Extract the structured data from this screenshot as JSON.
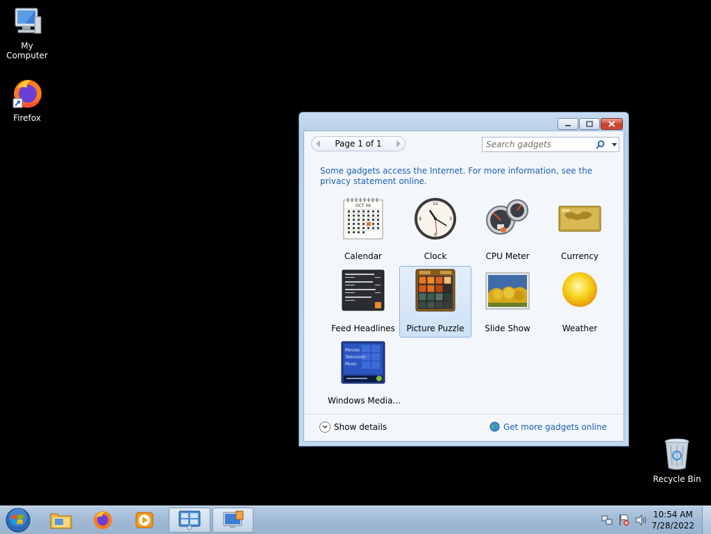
{
  "desktop": {
    "icons": [
      {
        "label": "My Computer"
      },
      {
        "label": "Firefox"
      },
      {
        "label": "Recycle Bin"
      }
    ]
  },
  "window": {
    "pager": {
      "text": "Page 1 of 1"
    },
    "search": {
      "placeholder": "Search gadgets"
    },
    "info_text": "Some gadgets access the Internet.  For more information, see the privacy statement online.",
    "gadgets": [
      {
        "name": "Calendar",
        "icon": "calendar-icon",
        "selected": false
      },
      {
        "name": "Clock",
        "icon": "clock-icon",
        "selected": false
      },
      {
        "name": "CPU Meter",
        "icon": "cpu-meter-icon",
        "selected": false
      },
      {
        "name": "Currency",
        "icon": "currency-icon",
        "selected": false
      },
      {
        "name": "Feed Headlines",
        "icon": "feed-headlines-icon",
        "selected": false
      },
      {
        "name": "Picture Puzzle",
        "icon": "picture-puzzle-icon",
        "selected": true
      },
      {
        "name": "Slide Show",
        "icon": "slide-show-icon",
        "selected": false
      },
      {
        "name": "Weather",
        "icon": "weather-icon",
        "selected": false
      },
      {
        "name": "Windows Media...",
        "icon": "windows-media-icon",
        "selected": false
      }
    ],
    "calendar_month": "OCT 06",
    "media_menu": [
      "Movies",
      "Television",
      "Music"
    ],
    "footer": {
      "show_details": "Show details",
      "get_more": "Get more gadgets online"
    }
  },
  "taskbar": {
    "time": "10:54 AM",
    "date": "7/28/2022"
  },
  "colors": {
    "link": "#1a5fb4",
    "selection": "#cfe1f6",
    "desktop": "#000000"
  }
}
